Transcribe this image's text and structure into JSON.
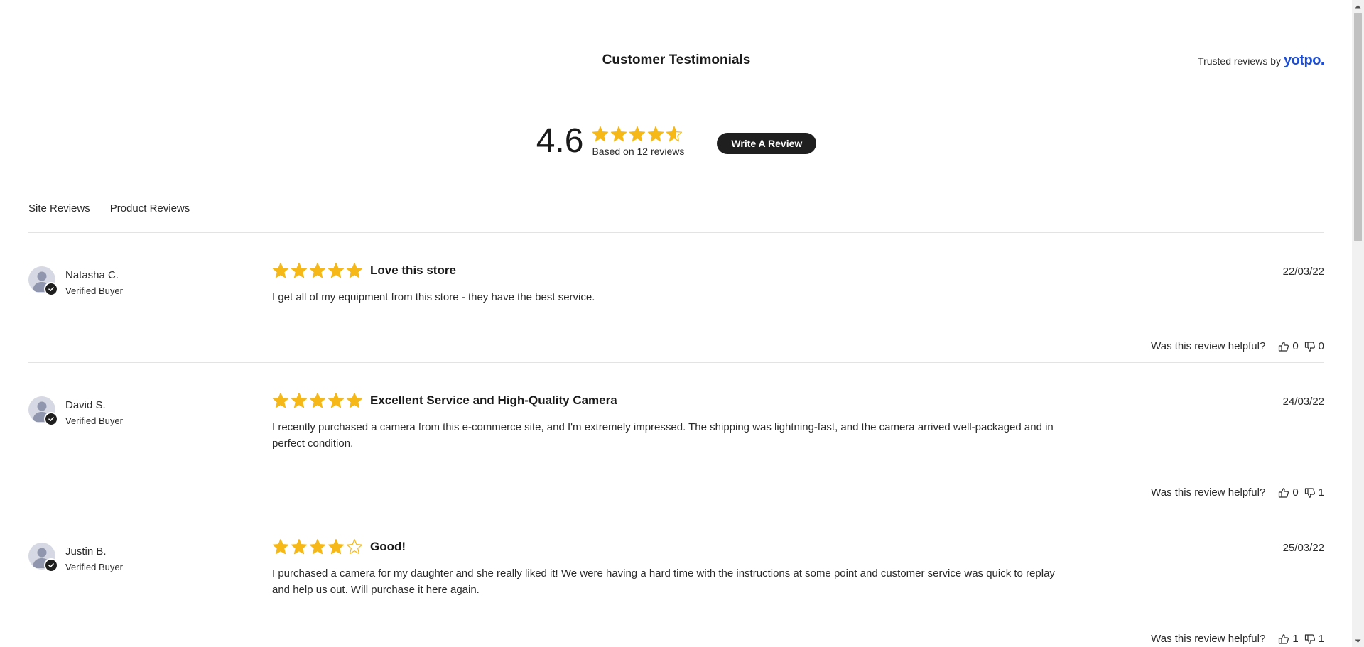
{
  "header": {
    "title": "Customer Testimonials",
    "trusted_prefix": "Trusted reviews by",
    "trusted_brand": "yotpo."
  },
  "summary": {
    "average": "4.6",
    "average_value": 4.6,
    "based_on": "Based on 12 reviews",
    "write_button": "Write A Review"
  },
  "tabs": [
    {
      "label": "Site Reviews",
      "active": true
    },
    {
      "label": "Product Reviews",
      "active": false
    }
  ],
  "colors": {
    "star": "#f5b817",
    "accent_brand": "#1d4ed8",
    "button_bg": "#1f1f1f"
  },
  "icons": {
    "star": "star-icon",
    "avatar": "user-avatar-icon",
    "verified": "check-badge-icon",
    "thumbs_up": "thumbs-up-icon",
    "thumbs_down": "thumbs-down-icon"
  },
  "reviews": [
    {
      "name": "Natasha C.",
      "verified": "Verified Buyer",
      "rating": 5,
      "title": "Love this store",
      "text": "I get all of my equipment from this store - they have the best service.",
      "date": "22/03/22",
      "helpful_label": "Was this review helpful?",
      "up": "0",
      "down": "0"
    },
    {
      "name": "David S.",
      "verified": "Verified Buyer",
      "rating": 5,
      "title": "Excellent Service and High-Quality Camera",
      "text": "I recently purchased a camera from this e-commerce site, and I'm extremely impressed. The shipping was lightning-fast, and the camera arrived well-packaged and in perfect condition.",
      "date": "24/03/22",
      "helpful_label": "Was this review helpful?",
      "up": "0",
      "down": "1"
    },
    {
      "name": "Justin B.",
      "verified": "Verified Buyer",
      "rating": 4,
      "title": "Good!",
      "text": "I purchased a camera for my daughter and she really liked it! We were having a hard time with the instructions at some point and customer service was quick to replay and help us out. Will purchase it here again.",
      "date": "25/03/22",
      "helpful_label": "Was this review helpful?",
      "up": "1",
      "down": "1"
    }
  ]
}
